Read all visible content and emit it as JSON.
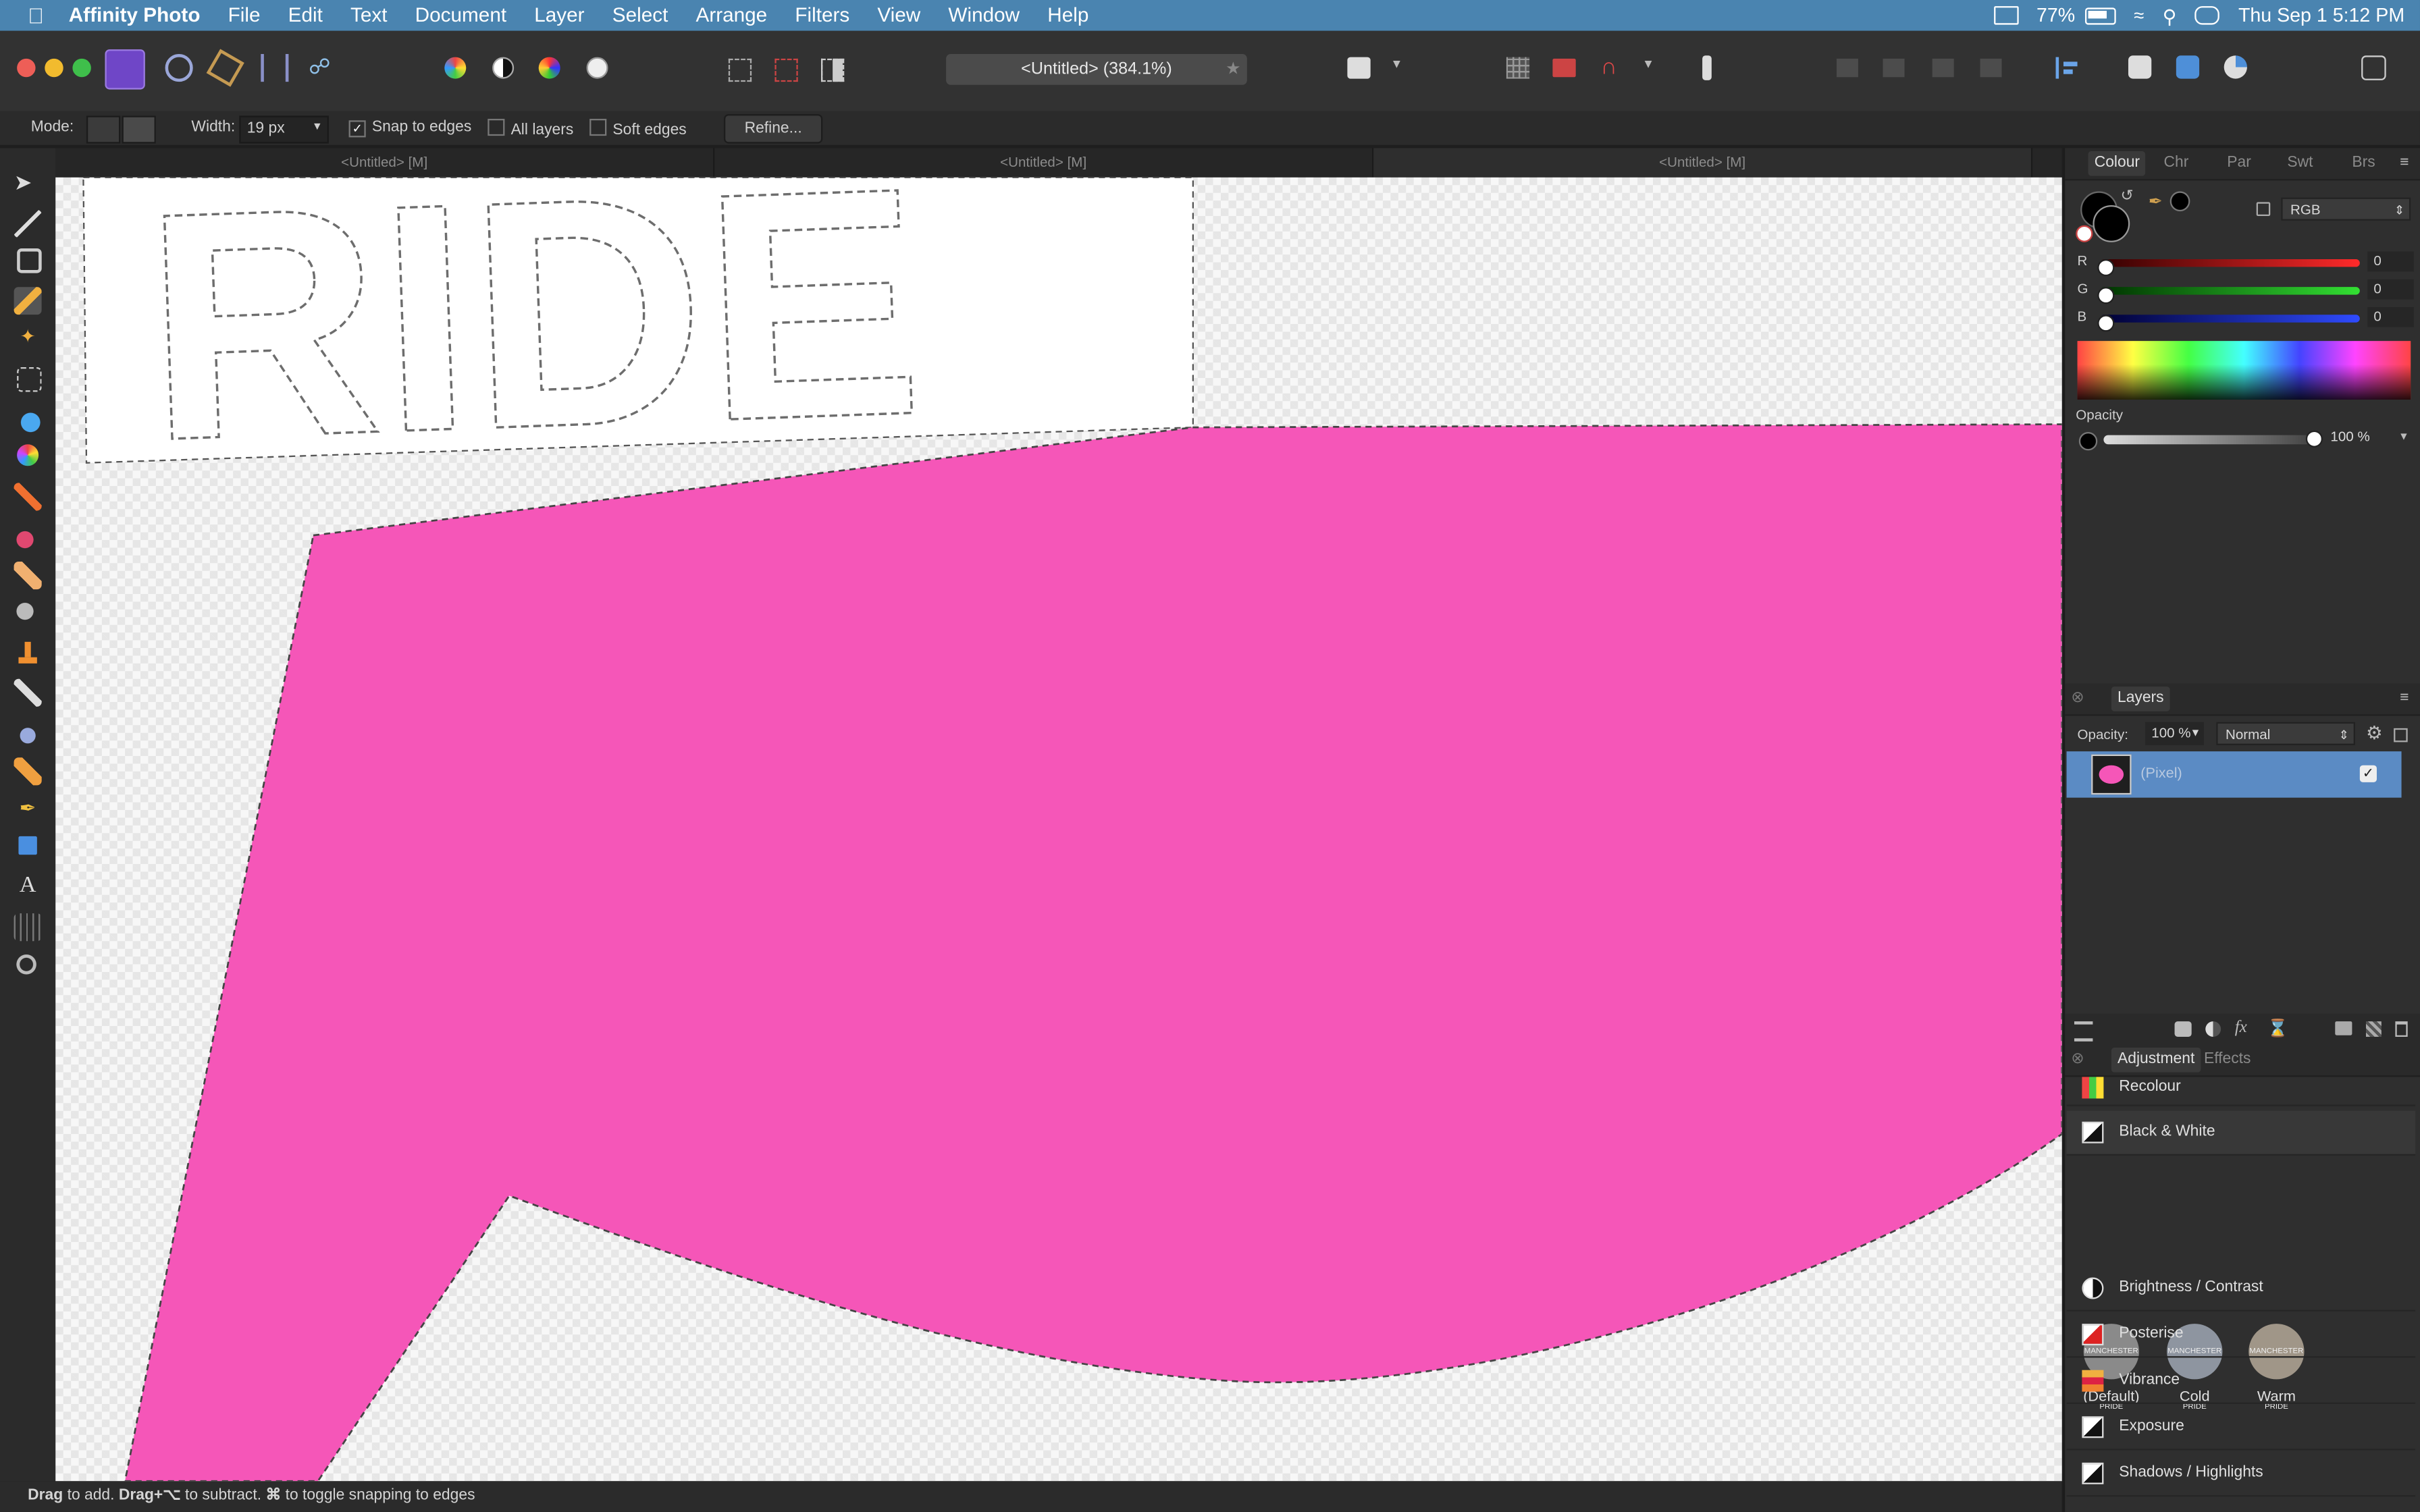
{
  "menubar": {
    "app_name": "Affinity Photo",
    "items": [
      "File",
      "Edit",
      "Text",
      "Document",
      "Layer",
      "Select",
      "Arrange",
      "Filters",
      "View",
      "Window",
      "Help"
    ],
    "battery": "77%",
    "clock": "Thu Sep 1  5:12 PM"
  },
  "toolbar": {
    "doc_title": "<Untitled> (384.1%)"
  },
  "context": {
    "mode_label": "Mode:",
    "width_label": "Width:",
    "width_value": "19 px",
    "snap_label": "Snap to edges",
    "all_layers_label": "All layers",
    "soft_edges_label": "Soft edges",
    "refine_label": "Refine...",
    "snap_check": "✓"
  },
  "tabs": [
    "<Untitled> [M]",
    "<Untitled> [M]",
    "<Untitled> [M]"
  ],
  "canvas": {
    "art_text": "RIDE",
    "fill_color": "#f556b8"
  },
  "status": {
    "b1": "Drag",
    "t1": " to add. ",
    "b2": "Drag+⌥",
    "t2": " to subtract. ",
    "b3": "⌘",
    "t3": " to toggle snapping to edges"
  },
  "colour_panel": {
    "tabs": [
      "Colour",
      "Chr",
      "Par",
      "Swt",
      "Brs"
    ],
    "model": "RGB",
    "channels": [
      {
        "label": "R",
        "value": "0"
      },
      {
        "label": "G",
        "value": "0"
      },
      {
        "label": "B",
        "value": "0"
      }
    ],
    "opacity_label": "Opacity",
    "opacity_value": "100 %"
  },
  "layers_panel": {
    "title": "Layers",
    "opacity_label": "Opacity:",
    "opacity_value": "100 %",
    "blend_mode": "Normal",
    "layer_name": "(Pixel)",
    "layer_checked": "✓"
  },
  "adjustment_panel": {
    "tabs": [
      "Adjustment",
      "Effects"
    ],
    "items": [
      "Recolour",
      "Black & White",
      "Brightness / Contrast",
      "Posterise",
      "Vibrance",
      "Exposure",
      "Shadows / Highlights"
    ],
    "presets": [
      "(Default)",
      "Cold",
      "Warm"
    ],
    "preset_art": "MANCHESTER PRIDE"
  }
}
